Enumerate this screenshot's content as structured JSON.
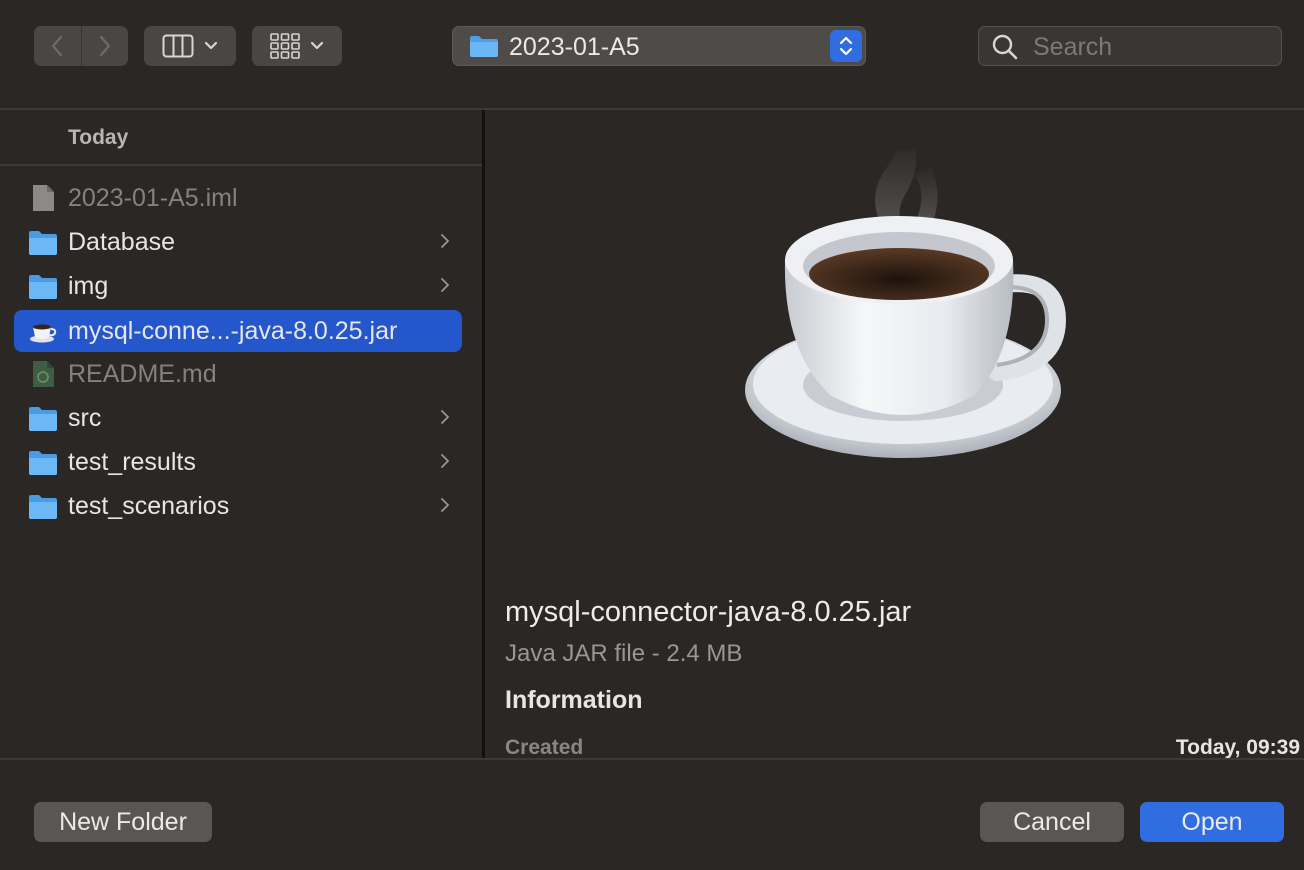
{
  "toolbar": {
    "path_label": "2023-01-A5",
    "search_placeholder": "Search"
  },
  "sidebar": {
    "section_header": "Today",
    "items": [
      {
        "name": "2023-01-A5.iml",
        "kind": "file",
        "dimmed": true
      },
      {
        "name": "Database",
        "kind": "folder"
      },
      {
        "name": "img",
        "kind": "folder"
      },
      {
        "name": "mysql-conne...-java-8.0.25.jar",
        "kind": "jar",
        "selected": true
      },
      {
        "name": "README.md",
        "kind": "markdown",
        "dimmed": true
      },
      {
        "name": "src",
        "kind": "folder"
      },
      {
        "name": "test_results",
        "kind": "folder"
      },
      {
        "name": "test_scenarios",
        "kind": "folder"
      }
    ]
  },
  "preview": {
    "file_name": "mysql-connector-java-8.0.25.jar",
    "kind_size": "Java JAR file - 2.4 MB",
    "info_header": "Information",
    "created_label": "Created",
    "created_value": "Today, 09:39"
  },
  "footer": {
    "new_folder_label": "New Folder",
    "cancel_label": "Cancel",
    "open_label": "Open"
  },
  "colors": {
    "background": "#2b2725",
    "selection": "#2457cc",
    "accent": "#2f6de0",
    "folder": "#5aaaf0"
  }
}
